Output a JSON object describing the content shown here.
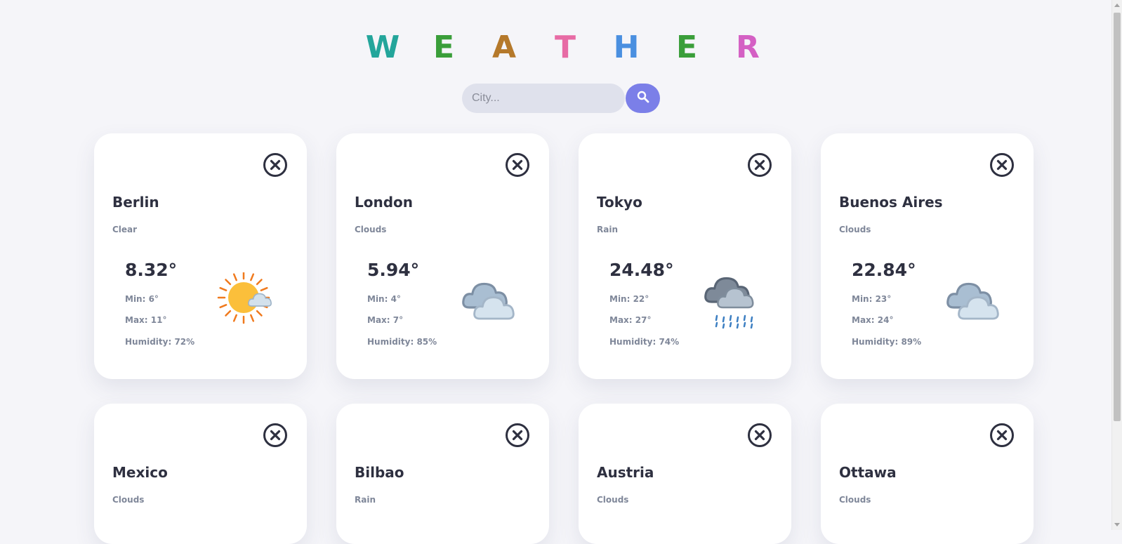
{
  "title": {
    "letters": [
      "W",
      "E",
      "A",
      "T",
      "H",
      "E",
      "R"
    ],
    "colors": [
      "#23a59b",
      "#3a9e3a",
      "#b5792b",
      "#e76ba5",
      "#4a8fe0",
      "#3a9e3a",
      "#d460c4"
    ]
  },
  "search": {
    "placeholder": "City...",
    "icon": "search-icon"
  },
  "cards": [
    {
      "city": "Berlin",
      "condition": "Clear",
      "temp": "8.32°",
      "min": "Min: 6°",
      "max": "Max: 11°",
      "humidity": "Humidity: 72%",
      "icon": "sun-cloud-icon"
    },
    {
      "city": "London",
      "condition": "Clouds",
      "temp": "5.94°",
      "min": "Min: 4°",
      "max": "Max: 7°",
      "humidity": "Humidity: 85%",
      "icon": "clouds-icon"
    },
    {
      "city": "Tokyo",
      "condition": "Rain",
      "temp": "24.48°",
      "min": "Min: 22°",
      "max": "Max: 27°",
      "humidity": "Humidity: 74%",
      "icon": "rain-cloud-icon"
    },
    {
      "city": "Buenos Aires",
      "condition": "Clouds",
      "temp": "22.84°",
      "min": "Min: 23°",
      "max": "Max: 24°",
      "humidity": "Humidity: 89%",
      "icon": "clouds-icon"
    },
    {
      "city": "Mexico",
      "condition": "Clouds"
    },
    {
      "city": "Bilbao",
      "condition": "Rain"
    },
    {
      "city": "Austria",
      "condition": "Clouds"
    },
    {
      "city": "Ottawa",
      "condition": "Clouds"
    }
  ]
}
